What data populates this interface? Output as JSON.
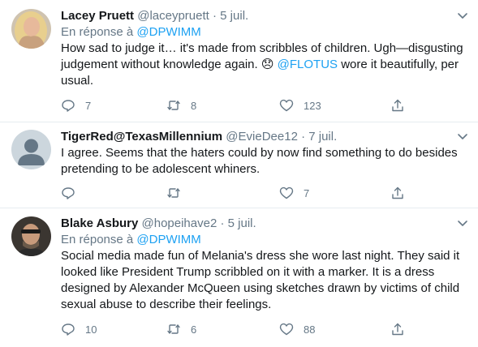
{
  "tweets": [
    {
      "name": "Lacey Pruett",
      "handle": "@laceypruett",
      "dot": "·",
      "date": "5 juil.",
      "reply_prefix": "En réponse à",
      "reply_to": "@DPWIMM",
      "text_part1": "How sad to judge it… it's made from scribbles of children. Ugh—disgusting judgement without knowledge again. 😞 ",
      "mention": "@FLOTUS",
      "text_part2": " wore it beautifully, per usual.",
      "replies": "7",
      "retweets": "8",
      "likes": "123"
    },
    {
      "name": "TigerRed@TexasMillennium",
      "handle": "@EvieDee12",
      "dot": "·",
      "date": "7 juil.",
      "text": "I agree. Seems that the haters could by now find something to do besides pretending to be adolescent whiners.",
      "replies": "",
      "retweets": "",
      "likes": "7"
    },
    {
      "name": "Blake Asbury",
      "handle": "@hopeihave2",
      "dot": "·",
      "date": "5 juil.",
      "reply_prefix": "En réponse à",
      "reply_to": "@DPWIMM",
      "text": "Social media made fun of Melania's dress she wore last night. They said it looked like President Trump scribbled on it with a marker. It is a dress designed by Alexander McQueen using sketches drawn by victims of child sexual abuse to describe their feelings.",
      "replies": "10",
      "retweets": "6",
      "likes": "88"
    }
  ],
  "icons": {
    "reply": "reply-icon",
    "retweet": "retweet-icon",
    "like": "heart-icon",
    "share": "share-icon",
    "caret": "chevron-down-icon"
  },
  "colors": {
    "link": "#1da1f2",
    "secondary_text": "#657786",
    "primary_text": "#14171a",
    "divider": "#e6ecf0"
  }
}
